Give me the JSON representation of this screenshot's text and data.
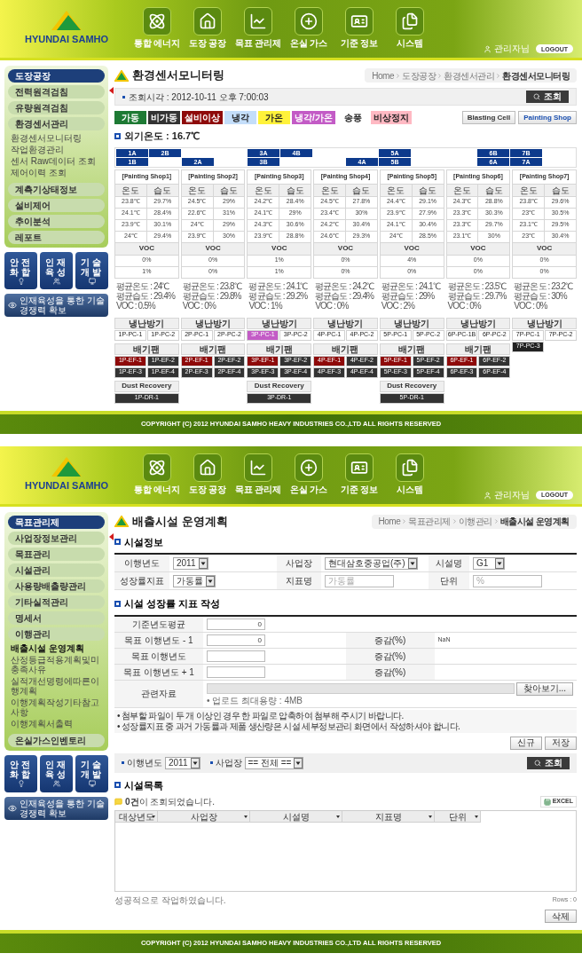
{
  "screens": [
    {
      "kind": "monitor",
      "header": {
        "logo": "HYUNDAI SAMHO",
        "nav": [
          "통합 에너지",
          "도장 공장",
          "목표 관리제",
          "온실 가스",
          "기준 정보",
          "시스템"
        ],
        "user": "관리자님",
        "logout": "LOGOUT"
      },
      "sidebar": {
        "title": "도장공장",
        "items": [
          {
            "label": "전력원격검침"
          },
          {
            "label": "유량원격검침"
          },
          {
            "label": "환경센서관리",
            "children": [
              {
                "label": "환경센서모니터링",
                "selected": false
              },
              {
                "label": "작업환경관리",
                "selected": false
              },
              {
                "label": "센서 Raw데이터 조회",
                "selected": false
              },
              {
                "label": "제어이력 조회",
                "selected": false
              }
            ]
          },
          {
            "label": "계측기상태정보"
          },
          {
            "label": "설비제어"
          },
          {
            "label": "추이분석"
          },
          {
            "label": "레포트"
          }
        ]
      },
      "banners": {
        "tiles": [
          "안전화합",
          "인재육성",
          "기술개발"
        ],
        "slogan": "인재육성을 통한 기술경쟁력 확보"
      },
      "content": {
        "title": "환경센서모니터링",
        "breadcrumb": [
          "Home",
          "도장공장",
          "환경센서관리",
          "환경센서모니터링"
        ],
        "query": {
          "label": "조회시각 : 2012-10-11 오후 7:00:03",
          "button": "조회"
        },
        "legend": [
          {
            "label": "가동",
            "color": "#1e7a34"
          },
          {
            "label": "비가동",
            "color": "#333333"
          },
          {
            "label": "설비이상",
            "color": "#8e0a0a"
          },
          {
            "label": "냉각",
            "color": "#c4defa"
          },
          {
            "label": "가온",
            "color": "#fff23a"
          },
          {
            "label": "냉각/가온",
            "color": "#c35bc6"
          },
          {
            "label": "송풍",
            "color": "#ffffff"
          },
          {
            "label": "비상정지",
            "color": "#ffb9c3"
          }
        ],
        "views": [
          {
            "label": "Blasting Cell",
            "selected": false
          },
          {
            "label": "Painting Shop",
            "selected": true
          }
        ],
        "outdoor": "외기온도 : 16.7℃",
        "zones": [
          [
            {
              "kind": "tag",
              "label": "1A"
            },
            {
              "kind": "tag",
              "label": "2B"
            },
            {
              "kind": "gap"
            },
            {
              "kind": "gap"
            },
            {
              "kind": "tag",
              "label": "3A"
            },
            {
              "kind": "tag",
              "label": "4B"
            },
            {
              "kind": "gap"
            },
            {
              "kind": "gap"
            },
            {
              "kind": "tag",
              "label": "5A"
            },
            {
              "kind": "gap"
            },
            {
              "kind": "gap"
            },
            {
              "kind": "tag",
              "label": "6B"
            },
            {
              "kind": "tag",
              "label": "7B"
            },
            {
              "kind": "gap"
            }
          ],
          [
            {
              "kind": "tag",
              "label": "1B"
            },
            {
              "kind": "gap"
            },
            {
              "kind": "tag",
              "label": "2A"
            },
            {
              "kind": "gap"
            },
            {
              "kind": "tag",
              "label": "3B"
            },
            {
              "kind": "gap"
            },
            {
              "kind": "gap"
            },
            {
              "kind": "tag",
              "label": "4A"
            },
            {
              "kind": "tag",
              "label": "5B"
            },
            {
              "kind": "gap"
            },
            {
              "kind": "gap"
            },
            {
              "kind": "tag",
              "label": "6A"
            },
            {
              "kind": "tag",
              "label": "7A"
            },
            {
              "kind": "gap"
            }
          ]
        ],
        "shops": [
          {
            "name": "[Painting Shop1]",
            "columns": [
              "온도",
              "습도"
            ],
            "readings": [
              [
                "23.8℃",
                "29.7%"
              ],
              [
                "24.1℃",
                "28.4%"
              ],
              [
                "23.9℃",
                "30.1%"
              ],
              [
                "24℃",
                "29.4%"
              ]
            ],
            "voc_title": "VOC",
            "voc": [
              "0%",
              "1%"
            ],
            "summary": [
              "평균온도 : 24℃",
              "평균습도 : 29.4%",
              "VOC : 0.5%"
            ],
            "hvac": {
              "title": "냉난방기",
              "units": [
                {
                  "label": "1P-PC-1",
                  "color": "#ffffff"
                },
                {
                  "label": "1P-PC-2",
                  "color": "#ffffff"
                }
              ]
            },
            "exhaust": {
              "title": "배기팬",
              "units": [
                {
                  "label": "1P-EF-1",
                  "color": "#8e0a0a"
                },
                {
                  "label": "1P-EF-2",
                  "color": "#333333"
                },
                {
                  "label": "1P-EF-3",
                  "color": "#333333"
                },
                {
                  "label": "1P-EF-4",
                  "color": "#333333"
                }
              ]
            },
            "dust": {
              "title": "Dust Recovery",
              "units": [
                {
                  "label": "1P-DR-1",
                  "color": "#333333"
                }
              ]
            }
          },
          {
            "name": "[Painting Shop2]",
            "columns": [
              "온도",
              "습도"
            ],
            "readings": [
              [
                "24.5℃",
                "29%"
              ],
              [
                "22.6℃",
                "31%"
              ],
              [
                "24℃",
                "29%"
              ],
              [
                "23.9℃",
                "30%"
              ]
            ],
            "voc_title": "VOC",
            "voc": [
              "0%",
              "0%"
            ],
            "summary": [
              "평균온도 : 23.8℃",
              "평균습도 : 29.8%",
              "VOC : 0%"
            ],
            "hvac": {
              "title": "냉난방기",
              "units": [
                {
                  "label": "2P-PC-1",
                  "color": "#ffffff"
                },
                {
                  "label": "2P-PC-2",
                  "color": "#ffffff"
                }
              ]
            },
            "exhaust": {
              "title": "배기팬",
              "units": [
                {
                  "label": "2P-EF-1",
                  "color": "#8e0a0a"
                },
                {
                  "label": "2P-EF-2",
                  "color": "#333333"
                },
                {
                  "label": "2P-EF-3",
                  "color": "#333333"
                },
                {
                  "label": "2P-EF-4",
                  "color": "#333333"
                }
              ]
            }
          },
          {
            "name": "[Painting Shop3]",
            "columns": [
              "온도",
              "습도"
            ],
            "readings": [
              [
                "24.2℃",
                "28.4%"
              ],
              [
                "24.1℃",
                "29%"
              ],
              [
                "24.3℃",
                "30.6%"
              ],
              [
                "23.9℃",
                "28.8%"
              ]
            ],
            "voc_title": "VOC",
            "voc": [
              "1%",
              "1%"
            ],
            "summary": [
              "평균온도 : 24.1℃",
              "평균습도 : 29.2%",
              "VOC : 1%"
            ],
            "hvac": {
              "title": "냉난방기",
              "units": [
                {
                  "label": "3P-PC-1",
                  "color": "#c35bc6"
                },
                {
                  "label": "3P-PC-2",
                  "color": "#ffffff"
                }
              ]
            },
            "exhaust": {
              "title": "배기팬",
              "units": [
                {
                  "label": "3P-EF-1",
                  "color": "#8e0a0a"
                },
                {
                  "label": "3P-EF-2",
                  "color": "#333333"
                },
                {
                  "label": "3P-EF-3",
                  "color": "#333333"
                },
                {
                  "label": "3P-EF-4",
                  "color": "#333333"
                }
              ]
            },
            "dust": {
              "title": "Dust Recovery",
              "units": [
                {
                  "label": "3P-DR-1",
                  "color": "#333333"
                }
              ]
            }
          },
          {
            "name": "[Painting Shop4]",
            "columns": [
              "온도",
              "습도"
            ],
            "readings": [
              [
                "24.5℃",
                "27.8%"
              ],
              [
                "23.4℃",
                "30%"
              ],
              [
                "24.2℃",
                "30.4%"
              ],
              [
                "24.6℃",
                "29.3%"
              ]
            ],
            "voc_title": "VOC",
            "voc": [
              "0%",
              "0%"
            ],
            "summary": [
              "평균온도 : 24.2℃",
              "평균습도 : 29.4%",
              "VOC : 0%"
            ],
            "hvac": {
              "title": "냉난방기",
              "units": [
                {
                  "label": "4P-PC-1",
                  "color": "#ffffff"
                },
                {
                  "label": "4P-PC-2",
                  "color": "#ffffff"
                }
              ]
            },
            "exhaust": {
              "title": "배기팬",
              "units": [
                {
                  "label": "4P-EF-1",
                  "color": "#8e0a0a"
                },
                {
                  "label": "4P-EF-2",
                  "color": "#333333"
                },
                {
                  "label": "4P-EF-3",
                  "color": "#333333"
                },
                {
                  "label": "4P-EF-4",
                  "color": "#333333"
                }
              ]
            }
          },
          {
            "name": "[Painting Shop5]",
            "columns": [
              "온도",
              "습도"
            ],
            "readings": [
              [
                "24.4℃",
                "29.1%"
              ],
              [
                "23.9℃",
                "27.9%"
              ],
              [
                "24.1℃",
                "30.4%"
              ],
              [
                "24℃",
                "28.5%"
              ]
            ],
            "voc_title": "VOC",
            "voc": [
              "4%",
              "0%"
            ],
            "summary": [
              "평균온도 : 24.1℃",
              "평균습도 : 29%",
              "VOC : 2%"
            ],
            "hvac": {
              "title": "냉난방기",
              "units": [
                {
                  "label": "5P-PC-1",
                  "color": "#ffffff"
                },
                {
                  "label": "5P-PC-2",
                  "color": "#ffffff"
                }
              ]
            },
            "exhaust": {
              "title": "배기팬",
              "units": [
                {
                  "label": "5P-EF-1",
                  "color": "#8e0a0a"
                },
                {
                  "label": "5P-EF-2",
                  "color": "#333333"
                },
                {
                  "label": "5P-EF-3",
                  "color": "#333333"
                },
                {
                  "label": "5P-EF-4",
                  "color": "#333333"
                }
              ]
            },
            "dust": {
              "title": "Dust Recovery",
              "units": [
                {
                  "label": "5P-DR-1",
                  "color": "#333333"
                }
              ]
            }
          },
          {
            "name": "[Painting Shop6]",
            "columns": [
              "온도",
              "습도"
            ],
            "readings": [
              [
                "24.3℃",
                "28.8%"
              ],
              [
                "23.3℃",
                "30.3%"
              ],
              [
                "23.3℃",
                "29.7%"
              ],
              [
                "23.1℃",
                "30%"
              ]
            ],
            "voc_title": "VOC",
            "voc": [
              "0%",
              "0%"
            ],
            "summary": [
              "평균온도 : 23.5℃",
              "평균습도 : 29.7%",
              "VOC : 0%"
            ],
            "hvac": {
              "title": "냉난방기",
              "units": [
                {
                  "label": "6P-PC-1B",
                  "color": "#ffffff"
                },
                {
                  "label": "6P-PC-2",
                  "color": "#ffffff"
                }
              ]
            },
            "exhaust": {
              "title": "배기팬",
              "units": [
                {
                  "label": "6P-EF-1",
                  "color": "#8e0a0a"
                },
                {
                  "label": "6P-EF-2",
                  "color": "#333333"
                },
                {
                  "label": "6P-EF-3",
                  "color": "#333333"
                },
                {
                  "label": "6P-EF-4",
                  "color": "#333333"
                }
              ]
            }
          },
          {
            "name": "[Painting Shop7]",
            "columns": [
              "온도",
              "습도"
            ],
            "readings": [
              [
                "23.8℃",
                "29.6%"
              ],
              [
                "23℃",
                "30.5%"
              ],
              [
                "23.1℃",
                "29.5%"
              ],
              [
                "23℃",
                "30.4%"
              ]
            ],
            "voc_title": "VOC",
            "voc": [
              "0%",
              "0%"
            ],
            "summary": [
              "평균온도 : 23.2℃",
              "평균습도 : 30%",
              "VOC : 0%"
            ],
            "hvac": {
              "title": "냉난방기",
              "units": [
                {
                  "label": "7P-PC-1",
                  "color": "#ffffff"
                },
                {
                  "label": "7P-PC-2",
                  "color": "#ffffff"
                },
                {
                  "label": "7P-PC-3",
                  "color": "#222222"
                }
              ]
            }
          }
        ]
      },
      "footer": "COPYRIGHT (C) 2012 HYUNDAI SAMHO HEAVY INDUSTRIES CO.,LTD ALL RIGHTS RESERVED"
    },
    {
      "kind": "plan",
      "header": {
        "logo": "HYUNDAI SAMHO",
        "nav": [
          "통합 에너지",
          "도장 공장",
          "목표 관리제",
          "온실 가스",
          "기준 정보",
          "시스템"
        ],
        "user": "관리자님",
        "logout": "LOGOUT"
      },
      "sidebar": {
        "title": "목표관리제",
        "items": [
          {
            "label": "사업장정보관리"
          },
          {
            "label": "목표관리"
          },
          {
            "label": "시설관리"
          },
          {
            "label": "사용량배출량관리"
          },
          {
            "label": "기타실적관리"
          },
          {
            "label": "명세서"
          },
          {
            "label": "이행관리",
            "children": [
              {
                "label": "배출시설 운영계획",
                "selected": true
              },
              {
                "label": "산정등급적용계획및미충족사유",
                "selected": false
              },
              {
                "label": "실적개선명령에따른이행계획",
                "selected": false
              },
              {
                "label": "이행계획작성기타참고사항",
                "selected": false
              },
              {
                "label": "이행계획서출력",
                "selected": false
              }
            ]
          },
          {
            "label": "온실가스인벤토리"
          }
        ]
      },
      "banners": {
        "tiles": [
          "안전화합",
          "인재육성",
          "기술개발"
        ],
        "slogan": "인재육성을 통한 기술경쟁력 확보"
      },
      "content": {
        "title": "배출시설 운영계획",
        "breadcrumb": [
          "Home",
          "목표관리제",
          "이행관리",
          "배출시설 운영계획"
        ],
        "info": {
          "heading": "시설정보",
          "rows": [
            [
              {
                "label": "이행년도",
                "kind": "select",
                "value": "2011"
              },
              {
                "label": "사업장",
                "kind": "select",
                "value": "현대삼호중공업(주)"
              },
              {
                "label": "시설명",
                "kind": "select",
                "value": "G1"
              }
            ],
            [
              {
                "label": "성장률지표",
                "kind": "select",
                "value": "가동률"
              },
              {
                "label": "지표명",
                "kind": "input",
                "placeholder": "가동률"
              },
              {
                "label": "단위",
                "kind": "input",
                "placeholder": "%"
              }
            ]
          ]
        },
        "growth": {
          "heading": "시설 성장률 지표 작성",
          "rows": [
            {
              "label": "기준년도평균",
              "value": "0"
            },
            {
              "label": "목표 이행년도 - 1",
              "value": "0",
              "change_label": "증감(%)",
              "change": "NaN"
            },
            {
              "label": "목표 이행년도",
              "change_label": "증감(%)"
            },
            {
              "label": "목표 이행년도 + 1",
              "change_label": "증감(%)"
            }
          ],
          "attachment": {
            "label": "관련자료",
            "button": "찾아보기...",
            "note": "• 업로드 최대용량 : 4MB"
          }
        },
        "notes": [
          "• 첨부할 파일이 두 개 이상인 경우 한 파일로 압축하여 첨부해 주시기 바랍니다.",
          "• 성장률지표 중 과거 가동률과 제품 생산량은 시설 세부정보관리 화면에서 작성하셔야 합니다."
        ],
        "actions": [
          "신규",
          "저장"
        ],
        "filter": {
          "fields": [
            {
              "label": "이행년도",
              "value": "2011"
            },
            {
              "label": "사업장",
              "value": "== 전체 =="
            }
          ],
          "button": "조회"
        },
        "list": {
          "heading": "시설목록",
          "count": "**0건**이 조회되었습니다.",
          "excel": "EXCEL",
          "columns": [
            "대상년도",
            "사업장",
            "시설명",
            "지표명",
            "단위"
          ],
          "status": "성공적으로 작업하였습니다.",
          "rows_info": "Rows : 0",
          "delete": "삭제"
        }
      },
      "footer": "COPYRIGHT (C) 2012 HYUNDAI SAMHO HEAVY INDUSTRIES CO.,LTD ALL RIGHTS RESERVED"
    }
  ]
}
